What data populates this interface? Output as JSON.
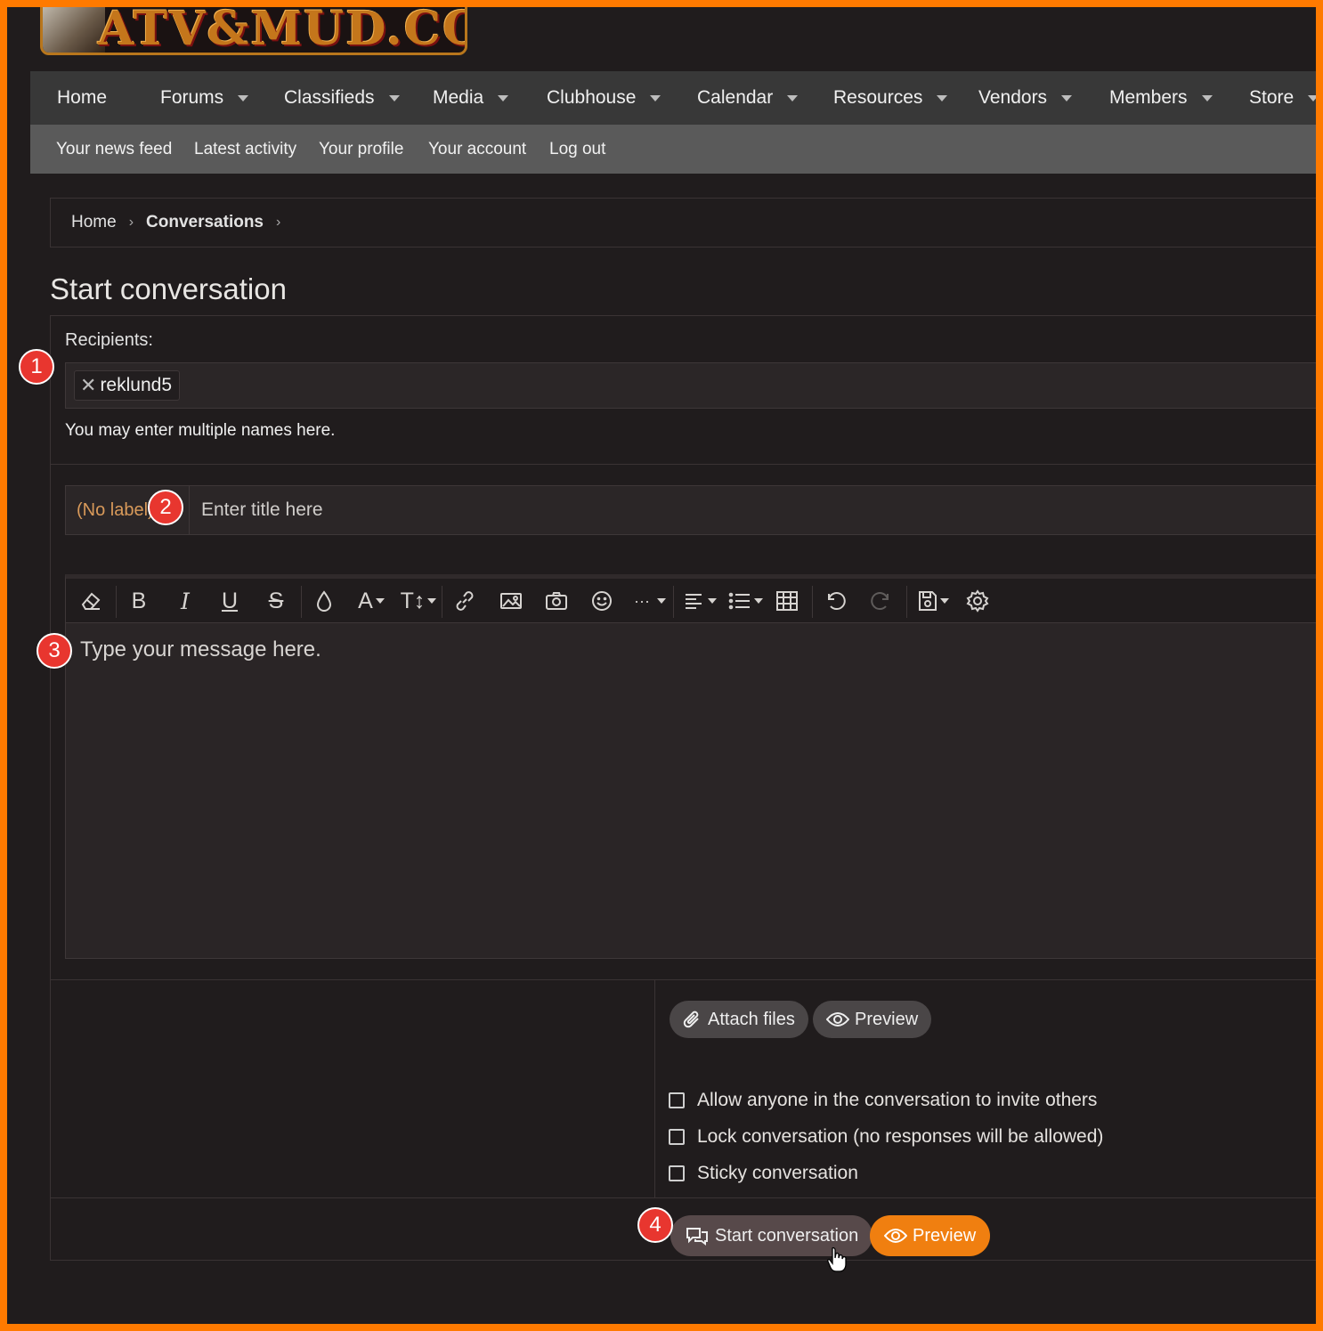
{
  "logo": {
    "text": "ATV&MUD.COM"
  },
  "nav": {
    "items": [
      {
        "label": "Home",
        "dropdown": false
      },
      {
        "label": "Forums",
        "dropdown": true
      },
      {
        "label": "Classifieds",
        "dropdown": true
      },
      {
        "label": "Media",
        "dropdown": true
      },
      {
        "label": "Clubhouse",
        "dropdown": true
      },
      {
        "label": "Calendar",
        "dropdown": true
      },
      {
        "label": "Resources",
        "dropdown": true
      },
      {
        "label": "Vendors",
        "dropdown": true
      },
      {
        "label": "Members",
        "dropdown": true
      },
      {
        "label": "Store",
        "dropdown": true
      }
    ]
  },
  "subnav": {
    "items": [
      {
        "label": "Your news feed"
      },
      {
        "label": "Latest activity"
      },
      {
        "label": "Your profile"
      },
      {
        "label": "Your account"
      },
      {
        "label": "Log out"
      }
    ]
  },
  "breadcrumb": {
    "home": "Home",
    "current": "Conversations",
    "separator": "›"
  },
  "page": {
    "title": "Start conversation"
  },
  "form": {
    "recipients_label": "Recipients:",
    "recipient_token": "reklund5",
    "recipient_remove": "✕",
    "recipients_hint": "You may enter multiple names here.",
    "prefix_label": "(No label)",
    "title_placeholder": "Enter title here",
    "message_placeholder": "Type your message here."
  },
  "toolbar": {
    "buttons": [
      "eraser-icon",
      "bold-icon",
      "italic-icon",
      "underline-icon",
      "strikethrough-icon",
      "text-color-icon",
      "font-family-icon",
      "font-size-icon",
      "link-icon",
      "image-icon",
      "camera-icon",
      "smiley-icon",
      "more-options-icon",
      "align-icon",
      "list-icon",
      "table-icon",
      "undo-icon",
      "redo-icon",
      "drafts-icon",
      "settings-icon"
    ],
    "bold": "B",
    "italic": "I",
    "underline": "U",
    "strike": "S",
    "font": "A",
    "size": "T↕",
    "more": "···"
  },
  "actions": {
    "attach_files": "Attach files",
    "preview_small": "Preview",
    "options": [
      "Allow anyone in the conversation to invite others",
      "Lock conversation (no responses will be allowed)",
      "Sticky conversation"
    ],
    "start_conversation": "Start conversation",
    "preview": "Preview"
  },
  "markers": [
    "1",
    "2",
    "3",
    "4"
  ],
  "colors": {
    "accent": "#f07f10",
    "frame": "#ff7a00",
    "background": "#201c1d",
    "marker": "#e8362f"
  }
}
